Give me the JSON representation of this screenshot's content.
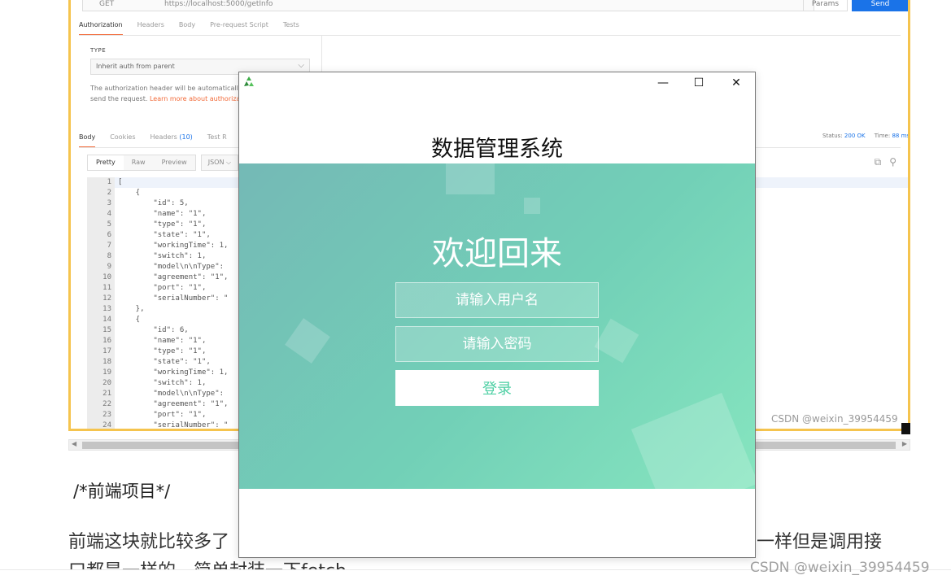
{
  "background_app": {
    "request_bar": {
      "method": "GET",
      "url": "https://localhost:5000/getInfo",
      "params_label": "Params",
      "send_label": "Send"
    },
    "request_tabs": [
      "Authorization",
      "Headers",
      "Body",
      "Pre-request Script",
      "Tests"
    ],
    "auth": {
      "type_label": "TYPE",
      "type_value": "Inherit auth from parent",
      "note": "The authorization header will be automatically g",
      "note_line2": "send the request.",
      "learn_more": "Learn more about authorizati"
    },
    "response_tabs": {
      "body": "Body",
      "cookies": "Cookies",
      "headers": "Headers",
      "headers_count": "(10)",
      "test_results": "Test R"
    },
    "status": {
      "status_label": "Status:",
      "status_value": "200 OK",
      "time_label": "Time:",
      "time_value": "88 ms"
    },
    "view_modes": [
      "Pretty",
      "Raw",
      "Preview"
    ],
    "format": "JSON",
    "code_lines": [
      "[",
      "    {",
      "        \"id\": 5,",
      "        \"name\": \"1\",",
      "        \"type\": \"1\",",
      "        \"state\": \"1\",",
      "        \"workingTime\": 1,",
      "        \"switch\": 1,",
      "        \"model\\n\\nType\":",
      "        \"agreement\": \"1\",",
      "        \"port\": \"1\",",
      "        \"serialNumber\": \"",
      "    },",
      "    {",
      "        \"id\": 6,",
      "        \"name\": \"1\",",
      "        \"type\": \"1\",",
      "        \"state\": \"1\",",
      "        \"workingTime\": 1,",
      "        \"switch\": 1,",
      "        \"model\\n\\nType\":",
      "        \"agreement\": \"1\",",
      "        \"port\": \"1\",",
      "        \"serialNumber\": \""
    ],
    "line_numbers": [
      "1",
      "2",
      "3",
      "4",
      "5",
      "6",
      "7",
      "8",
      "9",
      "10",
      "11",
      "12",
      "13",
      "14",
      "15",
      "16",
      "17",
      "18",
      "19",
      "20",
      "21",
      "22",
      "23",
      "24"
    ],
    "watermark": "CSDN @weixin_39954459"
  },
  "article": {
    "heading": "/*前端项目*/",
    "paragraph_left": "前端这块就比较多了",
    "paragraph_right": "一样但是调用接",
    "paragraph_line2": "口都是一样的，简单封装一下fetch",
    "watermark": "CSDN @weixin_39954459"
  },
  "login_window": {
    "controls": {
      "minimize": "—",
      "maximize": "☐",
      "close": "✕"
    },
    "system_title": "数据管理系统",
    "welcome": "欢迎回来",
    "username_placeholder": "请输入用户名",
    "password_placeholder": "请输入密码",
    "login_label": "登录",
    "colors": {
      "banner_start": "#74b9b6",
      "banner_end": "#86e5bf",
      "login_text": "#4ccfa3"
    }
  }
}
